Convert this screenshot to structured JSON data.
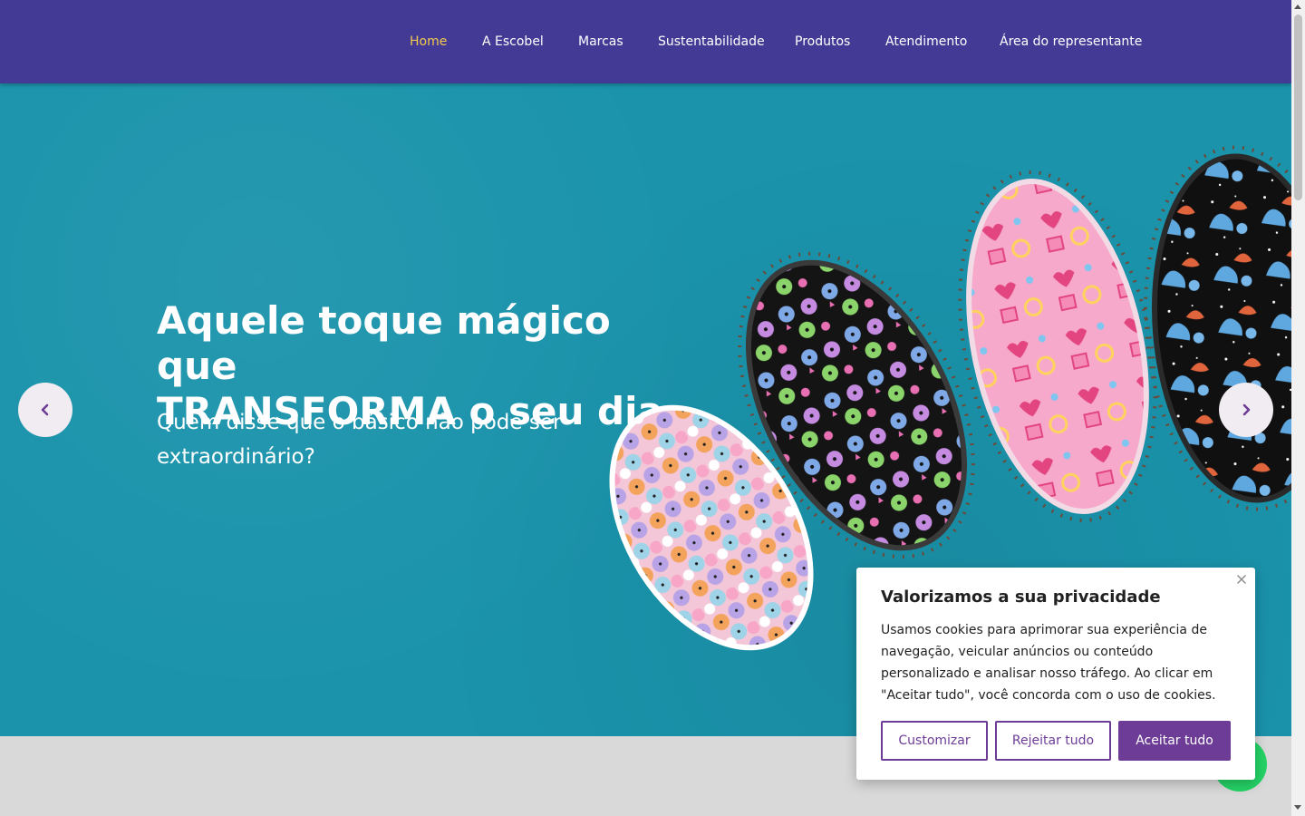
{
  "nav": {
    "items": [
      {
        "label": "Home",
        "active": true
      },
      {
        "label": "A Escobel",
        "active": false
      },
      {
        "label": "Marcas",
        "active": false
      },
      {
        "label": "Sustentabilidade",
        "active": false
      },
      {
        "label": "Produtos",
        "active": false
      },
      {
        "label": "Atendimento",
        "active": false
      },
      {
        "label": "Área do representante",
        "active": false
      }
    ]
  },
  "hero": {
    "title_line1": "Aquele toque mágico que",
    "title_line2": "TRANSFORMA o seu dia.",
    "subtitle": "Quem disse que o básico não pode ser extraordinário?",
    "prev_icon": "chevron-left-icon",
    "next_icon": "chevron-right-icon"
  },
  "cookie": {
    "title": "Valorizamos a sua privacidade",
    "text": "Usamos cookies para aprimorar sua experiência de navegação, veicular anúncios ou conteúdo personalizado e analisar nosso tráfego. Ao clicar em \"Aceitar tudo\", você concorda com o uso de cookies.",
    "btn_customize": "Customizar",
    "btn_reject": "Rejeitar tudo",
    "btn_accept": "Aceitar tudo",
    "close_icon": "close-icon"
  },
  "colors": {
    "nav_bg": "#433a96",
    "nav_active": "#f2c94c",
    "hero_bg": "#1a93ab",
    "accent": "#6d3c97",
    "whatsapp": "#25d366"
  }
}
